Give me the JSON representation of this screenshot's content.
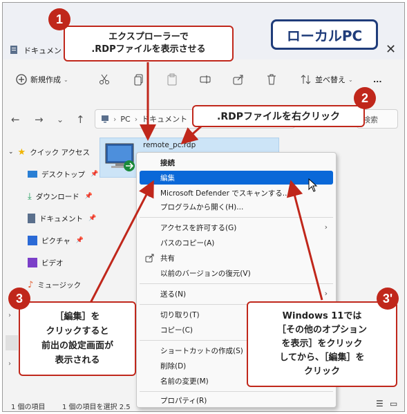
{
  "window": {
    "title": "ドキュメント",
    "close_glyph": "✕"
  },
  "toolbar": {
    "new_label": "新規作成",
    "sort_label": "並べ替え",
    "more_label": "..."
  },
  "address": {
    "crumb1": "PC",
    "crumb2": "ドキュメント",
    "search_placeholder": "検索"
  },
  "sidebar": {
    "items": [
      {
        "label": "クイック アクセス",
        "icon": "star-icon",
        "color": "#f0b400"
      },
      {
        "label": "デスクトップ",
        "icon": "desktop-icon",
        "color": "#2a7fd4"
      },
      {
        "label": "ダウンロード",
        "icon": "download-icon",
        "color": "#1e9b5a"
      },
      {
        "label": "ドキュメント",
        "icon": "document-icon",
        "color": "#5a6f8c"
      },
      {
        "label": "ピクチャ",
        "icon": "pictures-icon",
        "color": "#2b6ad6"
      },
      {
        "label": "ビデオ",
        "icon": "video-icon",
        "color": "#7b3fc8"
      },
      {
        "label": "ミュージック",
        "icon": "music-icon",
        "color": "#e35b2d"
      }
    ]
  },
  "file": {
    "name": "remote_pc.rdp"
  },
  "status": {
    "count": "1 個の項目",
    "selected": "1 個の項目を選択 2.5"
  },
  "context_menu": {
    "items": [
      {
        "label": "接続",
        "bold": true
      },
      {
        "label": "編集",
        "highlighted": true
      },
      {
        "label": "Microsoft Defender でスキャンする...",
        "icon": "defender-icon"
      },
      {
        "label": "プログラムから開く(H)..."
      },
      {
        "label": "アクセスを許可する(G)",
        "submenu": true
      },
      {
        "label": "パスのコピー(A)"
      },
      {
        "label": "共有",
        "icon": "share-icon"
      },
      {
        "label": "以前のバージョンの復元(V)"
      },
      {
        "label": "送る(N)",
        "submenu": true
      },
      {
        "label": "切り取り(T)"
      },
      {
        "label": "コピー(C)"
      },
      {
        "label": "ショートカットの作成(S)"
      },
      {
        "label": "削除(D)"
      },
      {
        "label": "名前の変更(M)"
      },
      {
        "label": "プロパティ(R)"
      }
    ]
  },
  "annotations": {
    "badge1": "1",
    "badge2": "2",
    "badge3": "3",
    "badge3p": "3'",
    "callout1_line1": "エクスプローラーで",
    "callout1_line2": ".RDPファイルを表示させる",
    "callout2": ".RDPファイルを右クリック",
    "callout3_line1": "［編集］を",
    "callout3_line2": "クリックすると",
    "callout3_line3": "前出の設定画面が",
    "callout3_line4": "表示される",
    "callout3p_line1": "Windows 11では",
    "callout3p_line2": "［その他のオプション",
    "callout3p_line3": "を表示］をクリック",
    "callout3p_line4": "してから、［編集］を",
    "callout3p_line5": "クリック",
    "local_pc": "ローカルPC"
  },
  "colors": {
    "accent_red": "#c0271b",
    "navy": "#1f3c7a",
    "selection": "#cce4f7",
    "menu_highlight": "#0a68d8"
  }
}
